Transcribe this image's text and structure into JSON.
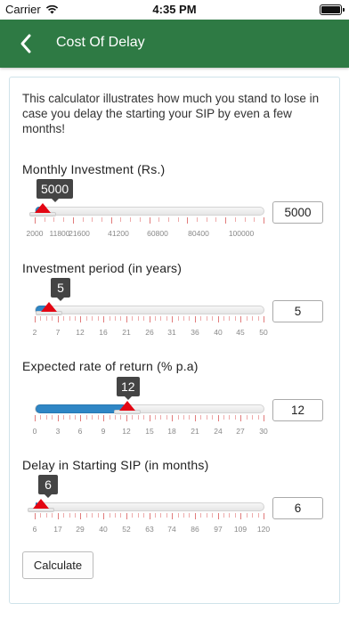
{
  "status_bar": {
    "carrier": "Carrier",
    "time": "4:35 PM"
  },
  "nav": {
    "title": "Cost Of Delay"
  },
  "intro": "This calculator illustrates how much you stand to lose in case you delay the starting your SIP by even a few months!",
  "sliders": [
    {
      "label": "Monthly Investment (Rs.)",
      "value": "5000",
      "bubble": "5000",
      "fill_fraction": 0.03,
      "tick_labels": [
        "2000",
        "11800",
        "21600",
        "41200",
        "60800",
        "80400",
        "100000"
      ]
    },
    {
      "label": "Investment period (in years)",
      "value": "5",
      "bubble": "5",
      "fill_fraction": 0.06,
      "tick_labels": [
        "2",
        "7",
        "12",
        "16",
        "21",
        "26",
        "31",
        "36",
        "40",
        "45",
        "50"
      ]
    },
    {
      "label": "Expected rate of return (% p.a)",
      "value": "12",
      "bubble": "12",
      "fill_fraction": 0.4,
      "tick_labels": [
        "0",
        "3",
        "6",
        "9",
        "12",
        "15",
        "18",
        "21",
        "24",
        "27",
        "30"
      ]
    },
    {
      "label": "Delay in Starting SIP (in months)",
      "value": "6",
      "bubble": "6",
      "fill_fraction": 0.0,
      "tick_labels": [
        "6",
        "17",
        "29",
        "40",
        "52",
        "63",
        "74",
        "86",
        "97",
        "109",
        "120"
      ]
    }
  ],
  "calculate_label": "Calculate",
  "colors": {
    "nav": "#2e7a44",
    "fill": "#2f86c5",
    "handle": "#e30613",
    "bubble": "#444444"
  },
  "icons": {
    "back": "chevron-left-icon",
    "wifi": "wifi-icon",
    "battery": "battery-icon"
  }
}
